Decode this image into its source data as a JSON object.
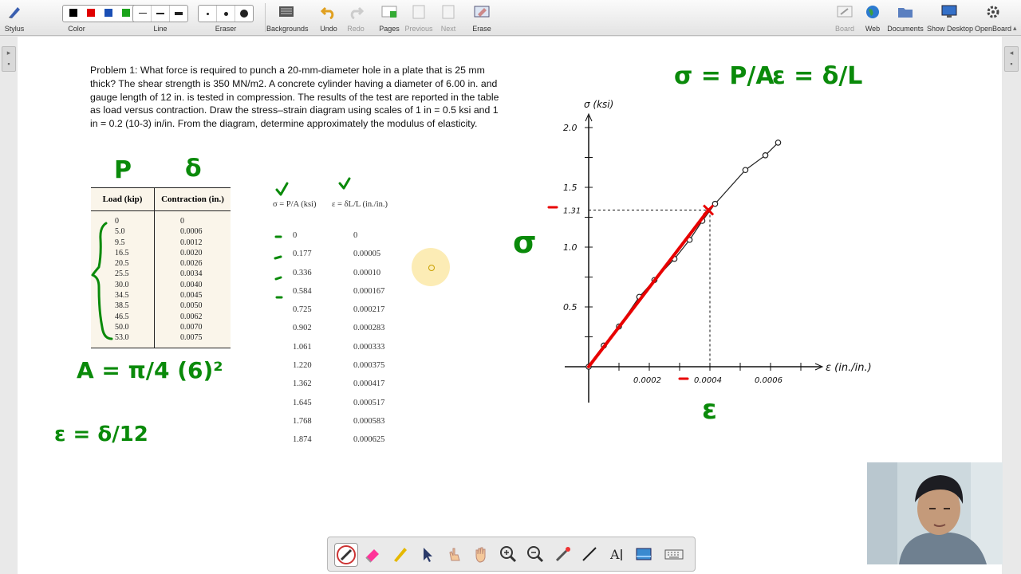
{
  "toolbar": {
    "stylus": "Stylus",
    "color": "Color",
    "line": "Line",
    "eraser": "Eraser",
    "backgrounds": "Backgrounds",
    "undo": "Undo",
    "redo": "Redo",
    "pages": "Pages",
    "previous": "Previous",
    "next": "Next",
    "erase": "Erase",
    "board": "Board",
    "web": "Web",
    "documents": "Documents",
    "show_desktop": "Show Desktop",
    "openboard": "OpenBoard",
    "colors": [
      "#000000",
      "#e00000",
      "#1a4fb5",
      "#1aa31a",
      "#f4e400"
    ]
  },
  "problem": {
    "text": "Problem 1: What force is required to punch a 20-mm-diameter hole in a plate that is 25 mm thick? The shear strength is 350 MN/m2. A concrete cylinder having a diameter of 6.00 in. and gauge length of 12 in. is tested in compression. The results of the test are reported in the table as load versus contraction. Draw the stress–strain diagram using scales of 1 in = 0.5 ksi and 1 in = 0.2 (10-3) in/in. From the diagram, determine approximately the modulus of elasticity."
  },
  "load_table": {
    "headers": [
      "Load (kip)",
      "Contraction (in.)"
    ],
    "load": [
      "0",
      "5.0",
      "9.5",
      "16.5",
      "20.5",
      "25.5",
      "30.0",
      "34.5",
      "38.5",
      "46.5",
      "50.0",
      "53.0"
    ],
    "contraction": [
      "0",
      "0.0006",
      "0.0012",
      "0.0020",
      "0.0026",
      "0.0034",
      "0.0040",
      "0.0045",
      "0.0050",
      "0.0062",
      "0.0070",
      "0.0075"
    ]
  },
  "stress_table": {
    "stress_header": "σ = P/A (ksi)",
    "strain_header": "ε = δL/L (in./in.)",
    "stress": [
      "0",
      "0.177",
      "0.336",
      "0.584",
      "0.725",
      "0.902",
      "1.061",
      "1.220",
      "1.362",
      "1.645",
      "1.768",
      "1.874"
    ],
    "strain": [
      "0",
      "0.00005",
      "0.00010",
      "0.000167",
      "0.000217",
      "0.000283",
      "0.000333",
      "0.000375",
      "0.000417",
      "0.000517",
      "0.000583",
      "0.000625"
    ]
  },
  "annotations": {
    "sigma_formula": "σ = P/A",
    "epsilon_formula": "ε = δ/L",
    "p_label": "P",
    "delta_label": "δ",
    "area_formula": "A = π/4 (6)²",
    "strain_formula": "ε = δ/12",
    "sigma_side": "σ",
    "epsilon_side": "ε",
    "red_value": "1.31"
  },
  "chart_data": {
    "type": "scatter",
    "ylabel": "σ (ksi)",
    "xlabel": "ε (in./in.)",
    "y_ticks": [
      "0.5",
      "1.0",
      "1.5",
      "2.0"
    ],
    "x_ticks": [
      "0.0002",
      "0.0004",
      "0.0006"
    ],
    "xlim": [
      0,
      0.00075
    ],
    "ylim": [
      0,
      2.0
    ],
    "points": [
      [
        0,
        0
      ],
      [
        5e-05,
        0.177
      ],
      [
        0.0001,
        0.336
      ],
      [
        0.000167,
        0.584
      ],
      [
        0.000217,
        0.725
      ],
      [
        0.000283,
        0.902
      ],
      [
        0.000333,
        1.061
      ],
      [
        0.000375,
        1.22
      ],
      [
        0.000417,
        1.362
      ],
      [
        0.000517,
        1.645
      ],
      [
        0.000583,
        1.768
      ],
      [
        0.000625,
        1.874
      ]
    ],
    "fit_line": {
      "color": "#e80000",
      "from": [
        0,
        0
      ],
      "to": [
        0.000395,
        1.31
      ]
    },
    "marked_point": {
      "x": 0.0004,
      "y": 1.31
    }
  },
  "palette": {
    "tools": [
      "pen",
      "eraser",
      "marker",
      "selector",
      "interactor",
      "hand",
      "zoom-in",
      "zoom-out",
      "laser",
      "line",
      "text",
      "capture",
      "keyboard"
    ]
  }
}
